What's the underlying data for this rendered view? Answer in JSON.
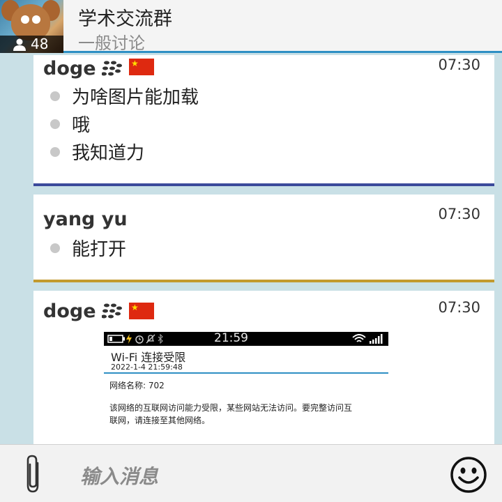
{
  "header": {
    "title": "学术交流群",
    "subtitle": "一般讨论",
    "member_count": "48"
  },
  "messages": [
    {
      "sender": "doge",
      "time": "07:30",
      "lines": [
        "为啥图片能加载",
        "哦",
        "我知道力"
      ],
      "stripe_color": "#3b4a9b"
    },
    {
      "sender": "yang yu",
      "time": "07:30",
      "lines": [
        "能打开"
      ],
      "stripe_color": "#c29a2e"
    },
    {
      "sender": "doge",
      "time": "07:30",
      "image": {
        "status_time": "21:59",
        "title": "Wi-Fi 连接受限",
        "datetime": "2022-1-4 21:59:48",
        "network_name": "网络名称:  702",
        "description": "该网络的互联网访问能力受限，某些网站无法访问。要完整访问互联网，请连接至其他网络。"
      }
    }
  ],
  "composer": {
    "placeholder": "输入消息"
  },
  "colors": {
    "accent": "#2e8fc4",
    "background": "#c9e0e6",
    "flag_red": "#de2910"
  },
  "icons": [
    "group-members-icon",
    "blackberry-icon",
    "china-flag-icon",
    "attach-icon",
    "emoji-icon",
    "battery-icon",
    "wifi-icon",
    "signal-icon"
  ]
}
